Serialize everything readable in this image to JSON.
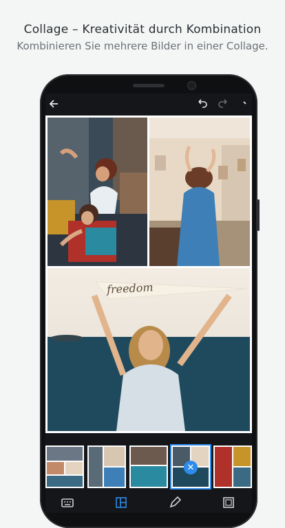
{
  "hero": {
    "title": "Collage – Kreativität durch Kombination",
    "subtitle": "Kombinieren Sie mehrere Bilder in einer Collage."
  },
  "toolbar": {
    "back_icon": "arrow-left-icon",
    "undo_icon": "undo-icon",
    "redo_icon": "redo-icon",
    "more_icon": "more-icon"
  },
  "collage": {
    "banner_text": "freedom"
  },
  "layout_thumbs": [
    "layout-1",
    "layout-2",
    "layout-3",
    "layout-4",
    "layout-5"
  ],
  "selected_thumb": 3,
  "bottom_tools": [
    "keyboard-icon",
    "layout-icon",
    "pencil-icon",
    "frame-icon"
  ],
  "colors": {
    "accent": "#2d8ceb",
    "background": "#f4f6f6",
    "phone": "#0f1012"
  }
}
